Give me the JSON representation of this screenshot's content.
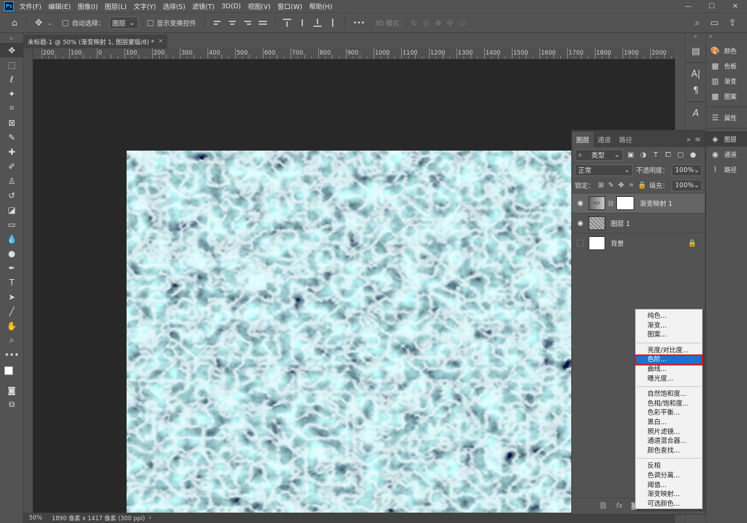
{
  "menubar": {
    "logo": "Ps",
    "items": [
      "文件(F)",
      "编辑(E)",
      "图像(I)",
      "图层(L)",
      "文字(Y)",
      "选择(S)",
      "滤镜(T)",
      "3D(D)",
      "视图(V)",
      "窗口(W)",
      "帮助(H)"
    ],
    "controls": {
      "minimize": "—",
      "maximize": "☐",
      "close": "✕"
    }
  },
  "options": {
    "auto_select_label": "自动选择：",
    "auto_select_value": "图层",
    "show_transform_label": "显示变换控件",
    "more": "•••",
    "mode_3d_label": "3D 模式："
  },
  "document": {
    "tab_title": "未标题-1 @ 50% (渐变映射 1, 图层蒙版/8) *",
    "tab_close": "×",
    "ruler_labels": [
      "200",
      "100",
      "0",
      "100",
      "200",
      "300",
      "400",
      "500",
      "600",
      "700",
      "800",
      "900",
      "1000",
      "1100",
      "1200",
      "1300",
      "1400",
      "1500",
      "1600",
      "1700",
      "1800",
      "1900",
      "2000"
    ]
  },
  "status": {
    "zoom": "50%",
    "info": "1890 像素 x 1417 像素 (300 ppi)",
    "arrow": "›"
  },
  "dock_right": {
    "group1": [
      {
        "icon": "color-palette-icon",
        "glyph": "🎨",
        "label": "颜色"
      },
      {
        "icon": "swatches-icon",
        "glyph": "▦",
        "label": "色板"
      },
      {
        "icon": "gradient-icon",
        "glyph": "▥",
        "label": "渐变"
      },
      {
        "icon": "pattern-icon",
        "glyph": "▩",
        "label": "图案"
      }
    ],
    "group2": [
      {
        "icon": "properties-icon",
        "glyph": "☰",
        "label": "属性"
      }
    ],
    "group3": [
      {
        "icon": "layers-icon",
        "glyph": "◈",
        "label": "图层"
      },
      {
        "icon": "channels-icon",
        "glyph": "◉",
        "label": "通道"
      },
      {
        "icon": "paths-icon",
        "glyph": "⌇",
        "label": "路径"
      }
    ]
  },
  "layers_panel": {
    "tabs": [
      "图层",
      "通道",
      "路径"
    ],
    "filter_type": "类型",
    "blend_mode": "正常",
    "opacity_label": "不透明度：",
    "opacity_value": "100%",
    "lock_label": "锁定：",
    "fill_label": "填充：",
    "fill_value": "100%",
    "layers": [
      {
        "name": "渐变映射 1",
        "visible": true,
        "selected": true
      },
      {
        "name": "图层 1",
        "visible": true,
        "selected": false
      },
      {
        "name": "背景",
        "visible": false,
        "selected": false,
        "locked": true
      }
    ]
  },
  "context_menu": {
    "group1": [
      "纯色...",
      "渐变...",
      "图案..."
    ],
    "group2": [
      "亮度/对比度...",
      "色阶...",
      "曲线...",
      "曝光度..."
    ],
    "group3": [
      "自然饱和度...",
      "色相/饱和度...",
      "色彩平衡...",
      "黑白...",
      "照片滤镜...",
      "通道混合器...",
      "颜色查找..."
    ],
    "group4": [
      "反相",
      "色调分离...",
      "阈值...",
      "渐变映射...",
      "可选颜色..."
    ],
    "highlighted": "色阶..."
  },
  "colors": {
    "accent_highlight": "#1a73cc",
    "highlight_frame": "#e01a1a",
    "canvas_teal": "#3c9aa6"
  }
}
